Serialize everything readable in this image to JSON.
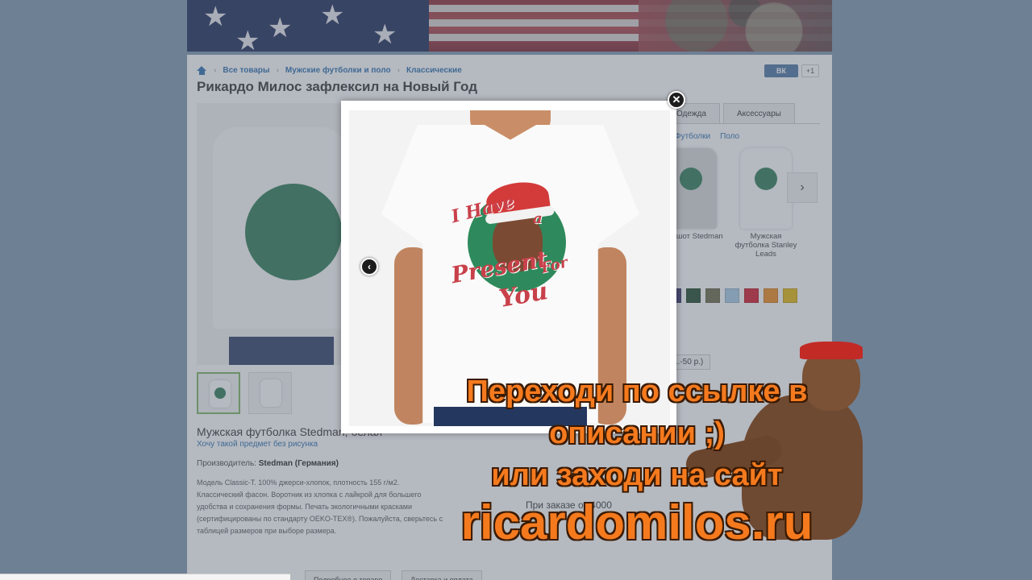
{
  "breadcrumb": {
    "items": [
      "Все товары",
      "Мужские футболки и поло",
      "Классические"
    ]
  },
  "product": {
    "title": "Рикардо Милос зафлексил на Новый Год",
    "name": "Мужская футболка Stedman, белая",
    "no_print_link": "Хочу такой предмет без рисунка",
    "maker_label": "Производитель:",
    "maker_value": "Stedman (Германия)",
    "description": "Модель Classic-T. 100% джерси-хлопок, плотность 155 г/м2. Классический фасон. Воротник из хлопка с лайкрой для большего удобства и сохранения формы. Печать экологичными красками (сертифицированы по стандарту OEKO-TEX®). Пожалуйста, сверьтесь с таблицей размеров при выборе размера."
  },
  "share": {
    "vk": "ВК",
    "plus": "+1"
  },
  "tabs": [
    "Одежда",
    "Аксессуары"
  ],
  "filter_links": [
    "Футболки",
    "Поло"
  ],
  "carousel": [
    {
      "label": "Свитшот Stedman",
      "color": "gray"
    },
    {
      "label": "Мужская футболка Stanley Leads",
      "color": "white"
    }
  ],
  "swatches": [
    "#3a3370",
    "#1f4a2a",
    "#6b6b4a",
    "#a8cde6",
    "#d4192b",
    "#f08a1c",
    "#e5b810"
  ],
  "price_pill": "...-50 р.)",
  "order_text": "При заказе от 4000",
  "bottom_buttons": [
    "Подробнее о товаре",
    "Доставка и оплата"
  ],
  "print": {
    "line1": "I Have",
    "line2": "a",
    "line3": "Present",
    "line4": "For",
    "line5": "You"
  },
  "promo": {
    "line1": "Переходи по ссылке в",
    "line2": "описании ;)",
    "line3": "или заходи на сайт",
    "site": "ricardomilos.ru"
  },
  "icons": {
    "close": "close-icon",
    "prev": "chevron-left-icon",
    "next": "chevron-right-icon",
    "home": "home-icon"
  },
  "colors": {
    "accent": "#f57a1e",
    "link": "#2a6fb0",
    "print_green": "#2e8a5c",
    "print_red": "#c8414a"
  }
}
